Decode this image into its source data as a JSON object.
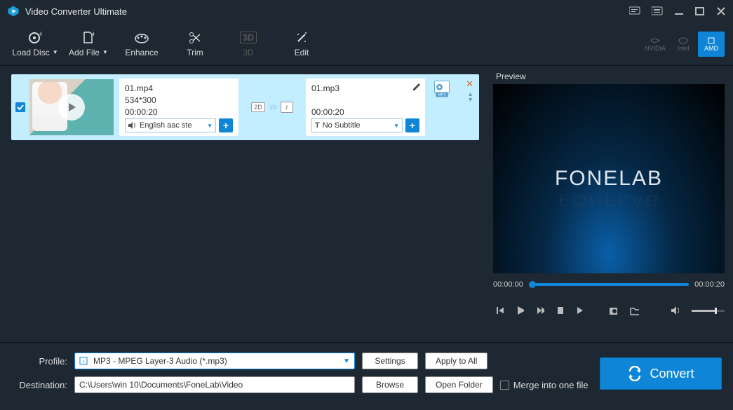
{
  "app": {
    "title": "Video Converter Ultimate"
  },
  "toolbar": {
    "load_disc": "Load Disc",
    "add_file": "Add File",
    "enhance": "Enhance",
    "trim": "Trim",
    "three_d": "3D",
    "edit": "Edit"
  },
  "hw": {
    "nvidia": "NVIDIA",
    "intel": "Intel",
    "amd": "AMD"
  },
  "file": {
    "src_name": "01.mp4",
    "src_res": "534*300",
    "src_dur": "00:00:20",
    "dst_name": "01.mp3",
    "dst_dur": "00:00:20",
    "audio_label": "English aac ste",
    "subtitle_label": "No Subtitle",
    "badge_2d": "2D",
    "fmt_badge": "MP3"
  },
  "preview": {
    "title": "Preview",
    "brand": "FONELAB",
    "time_start": "00:00:00",
    "time_end": "00:00:20"
  },
  "bottom": {
    "profile_label": "Profile:",
    "profile_value": "MP3 - MPEG Layer-3 Audio (*.mp3)",
    "settings": "Settings",
    "apply_all": "Apply to All",
    "dest_label": "Destination:",
    "dest_value": "C:\\Users\\win 10\\Documents\\FoneLab\\Video",
    "browse": "Browse",
    "open_folder": "Open Folder",
    "merge": "Merge into one file",
    "convert": "Convert"
  }
}
